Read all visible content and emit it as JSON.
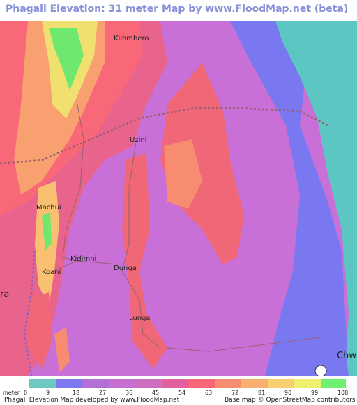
{
  "title": "Phagali Elevation: 31 meter Map by www.FloodMap.net (beta)",
  "places": [
    {
      "id": "kilombero",
      "name": "Kilombero"
    },
    {
      "id": "uzini",
      "name": "Uzini"
    },
    {
      "id": "machui",
      "name": "Machui"
    },
    {
      "id": "kidimni",
      "name": "Kidimni"
    },
    {
      "id": "koani",
      "name": "Koani"
    },
    {
      "id": "dunga",
      "name": "Dunga"
    },
    {
      "id": "lunga",
      "name": "Lunga"
    },
    {
      "id": "chwa",
      "name": "Chwa"
    },
    {
      "id": "ra",
      "name": "ra"
    }
  ],
  "legend": {
    "unit": "meter",
    "labels": [
      "0",
      "9",
      "18",
      "27",
      "36",
      "45",
      "54",
      "63",
      "72",
      "81",
      "90",
      "99",
      "108"
    ],
    "colors": [
      "#6cc8c0",
      "#7b78f0",
      "#b070d8",
      "#c870d0",
      "#cf6ec0",
      "#e060a0",
      "#f86878",
      "#f88c70",
      "#f8b070",
      "#f8d070",
      "#f0f070",
      "#70f070",
      "#70e070"
    ]
  },
  "credits": {
    "left": "Phagali Elevation Map developed by www.FloodMap.net",
    "right": "Base map © OpenStreetMap contributors"
  },
  "colors": {
    "sea": "#5cc6c2",
    "low_land": "#7a78f0",
    "mid_land": "#c870d8",
    "high_land": "#f06878",
    "peak": "#70e870",
    "road": "#9a6070",
    "boundary": "#9060c0"
  }
}
